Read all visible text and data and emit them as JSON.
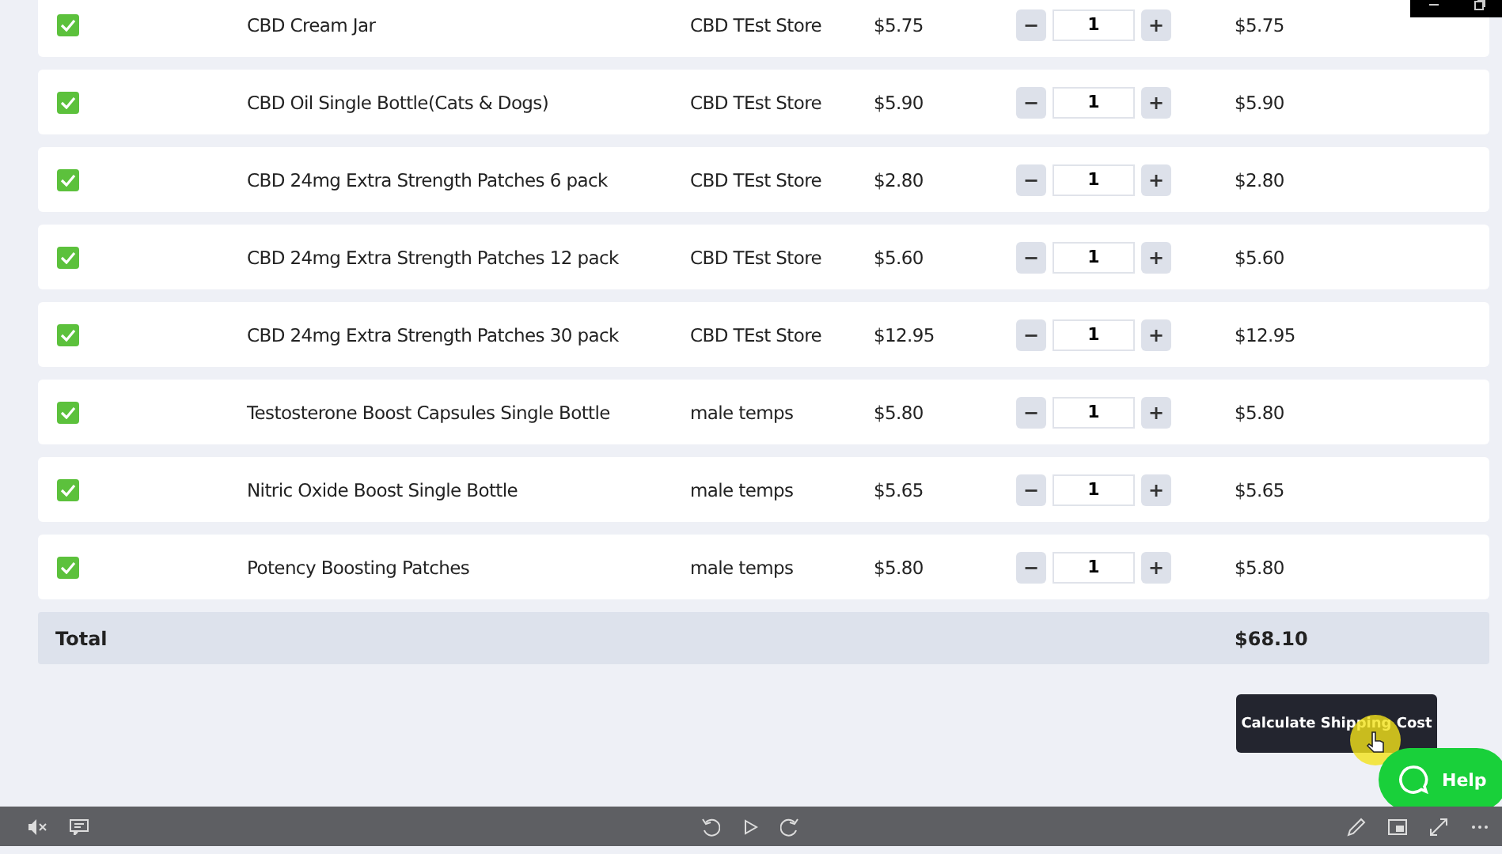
{
  "cart": {
    "rows": [
      {
        "checked": true,
        "name": "CBD Cream Jar",
        "store": "CBD TEst Store",
        "price": "$5.75",
        "qty": "1",
        "subtotal": "$5.75"
      },
      {
        "checked": true,
        "name": "CBD Oil Single Bottle(Cats & Dogs)",
        "store": "CBD TEst Store",
        "price": "$5.90",
        "qty": "1",
        "subtotal": "$5.90"
      },
      {
        "checked": true,
        "name": "CBD 24mg Extra Strength Patches 6 pack",
        "store": "CBD TEst Store",
        "price": "$2.80",
        "qty": "1",
        "subtotal": "$2.80"
      },
      {
        "checked": true,
        "name": "CBD 24mg Extra Strength Patches 12 pack",
        "store": "CBD TEst Store",
        "price": "$5.60",
        "qty": "1",
        "subtotal": "$5.60"
      },
      {
        "checked": true,
        "name": "CBD 24mg Extra Strength Patches 30 pack",
        "store": "CBD TEst Store",
        "price": "$12.95",
        "qty": "1",
        "subtotal": "$12.95"
      },
      {
        "checked": true,
        "name": "Testosterone Boost Capsules Single Bottle",
        "store": "male temps",
        "price": "$5.80",
        "qty": "1",
        "subtotal": "$5.80"
      },
      {
        "checked": true,
        "name": "Nitric Oxide Boost Single Bottle",
        "store": "male temps",
        "price": "$5.65",
        "qty": "1",
        "subtotal": "$5.65"
      },
      {
        "checked": true,
        "name": "Potency Boosting Patches",
        "store": "male temps",
        "price": "$5.80",
        "qty": "1",
        "subtotal": "$5.80"
      }
    ],
    "total": {
      "label": "Total",
      "value": "$68.10"
    }
  },
  "shipping_button": "Calculate Shipping Cost",
  "help_button": "Help",
  "decrement_label": "−",
  "increment_label": "+"
}
